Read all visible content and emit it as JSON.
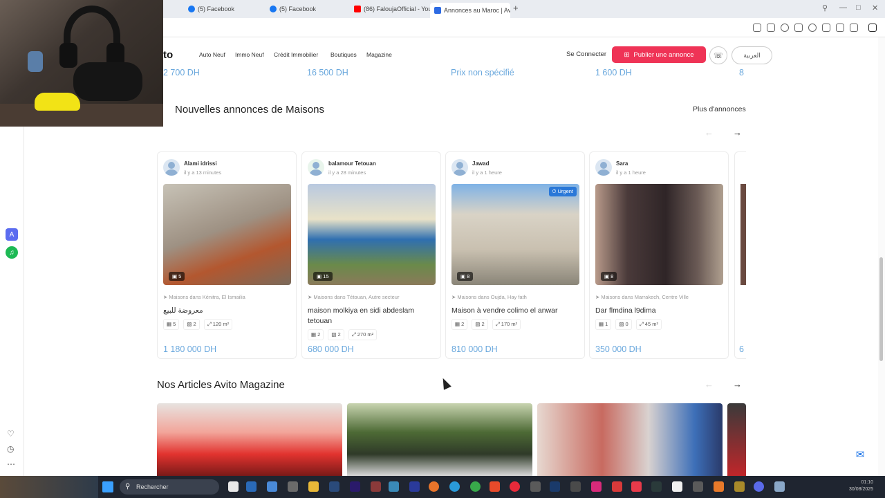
{
  "browser": {
    "tabs": [
      {
        "label": "(5) Facebook",
        "favicon_color": "#1877f2"
      },
      {
        "label": "(5) Facebook",
        "favicon_color": "#1877f2"
      },
      {
        "label": "(86) FaloujaOfficial - YouT",
        "favicon_color": "#ff0000"
      },
      {
        "label": "Annonces au Maroc | Avit",
        "favicon_color": "#2d6be3",
        "active": true
      }
    ],
    "new_tab": "+"
  },
  "site": {
    "logo": "to",
    "nav": [
      "Auto Neuf",
      "Immo Neuf",
      "Crédit Immobilier",
      "Boutiques",
      "Magazine"
    ],
    "connect": "Se Connecter",
    "publish": "Publier une annonce",
    "lang": "العربية"
  },
  "prev_prices": [
    "2 700 DH",
    "16 500 DH",
    "Prix non spécifié",
    "1 600 DH",
    "8"
  ],
  "houses": {
    "title": "Nouvelles annonces de Maisons",
    "more": "Plus d'annonces",
    "cards": [
      {
        "seller": "Alami idrissi",
        "time": "il y a 13 minutes",
        "photos": "5",
        "location": "Maisons dans Kénitra, El Ismailia",
        "title": "معروضة للبيع",
        "specs": [
          "5",
          "2",
          "120 m²"
        ],
        "price": "1 180 000 DH"
      },
      {
        "seller": "balamour Tetouan",
        "time": "il y a 28 minutes",
        "photos": "15",
        "location": "Maisons dans Tétouan, Autre secteur",
        "title": "maison molkiya en sidi abdeslam tetouan",
        "specs": [
          "2",
          "2",
          "270 m²"
        ],
        "price": "680 000 DH"
      },
      {
        "seller": "Jawad",
        "time": "il y a 1 heure",
        "photos": "8",
        "urgent": "Urgent",
        "location": "Maisons dans Oujda, Hay fath",
        "title": "Maison à vendre colimo el anwar",
        "specs": [
          "2",
          "2",
          "170 m²"
        ],
        "price": "810 000 DH"
      },
      {
        "seller": "Sara",
        "time": "il y a 1 heure",
        "photos": "8",
        "location": "Maisons dans Marrakech, Centre Ville",
        "title": "Dar flmdina l9dima",
        "specs": [
          "1",
          "0",
          "45 m²"
        ],
        "price": "350 000 DH"
      }
    ],
    "peek_price": "6"
  },
  "magazine": {
    "title": "Nos Articles Avito Magazine"
  },
  "taskbar": {
    "search": "Rechercher",
    "time": "01:10",
    "date": "30/08/2025"
  },
  "colors": {
    "accent_red": "#ef3356",
    "price_blue": "#6aa8dd",
    "urgent_blue": "#2a78d8"
  }
}
